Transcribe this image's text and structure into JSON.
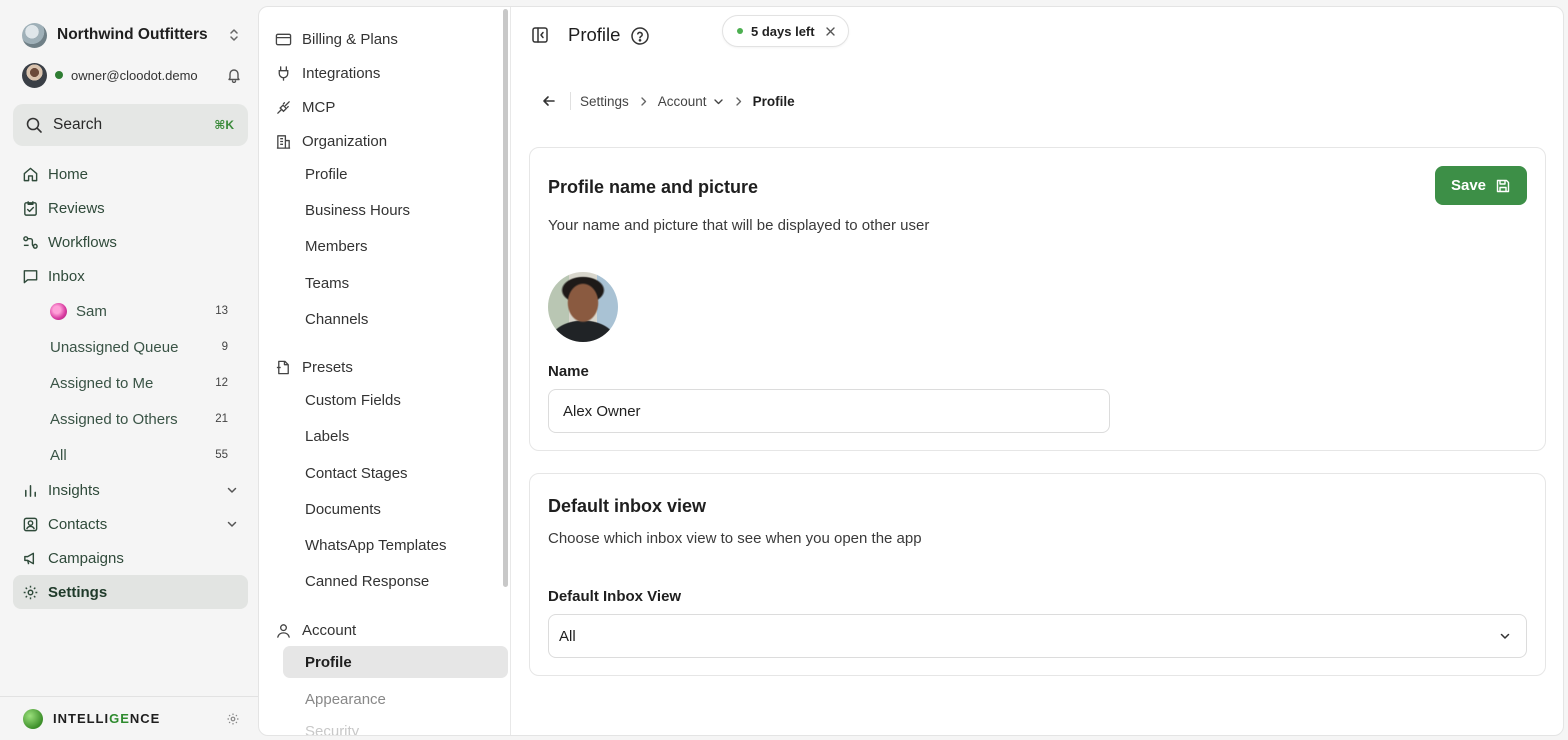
{
  "workspace": {
    "name": "Northwind Outfitters"
  },
  "user": {
    "email": "owner@cloodot.demo"
  },
  "search": {
    "label": "Search",
    "shortcut": "⌘K"
  },
  "nav": {
    "home": "Home",
    "reviews": "Reviews",
    "workflows": "Workflows",
    "inbox": "Inbox",
    "inbox_items": [
      {
        "label": "Sam",
        "count": "13"
      },
      {
        "label": "Unassigned Queue",
        "count": "9"
      },
      {
        "label": "Assigned to Me",
        "count": "12"
      },
      {
        "label": "Assigned to Others",
        "count": "21"
      },
      {
        "label": "All",
        "count": "55"
      }
    ],
    "insights": "Insights",
    "contacts": "Contacts",
    "campaigns": "Campaigns",
    "settings": "Settings"
  },
  "intelligence": {
    "label_pre": "INTELLI",
    "label_accent": "GE",
    "label_post": "NCE"
  },
  "settings_nav": {
    "billing": "Billing & Plans",
    "integrations": "Integrations",
    "mcp": "MCP",
    "organization": "Organization",
    "org_items": [
      "Profile",
      "Business Hours",
      "Members",
      "Teams",
      "Channels"
    ],
    "presets": "Presets",
    "preset_items": [
      "Custom Fields",
      "Labels",
      "Contact Stages",
      "Documents",
      "WhatsApp Templates",
      "Canned Response"
    ],
    "account": "Account",
    "account_items": [
      "Profile",
      "Appearance",
      "Security"
    ]
  },
  "header": {
    "title": "Profile",
    "trial": "5 days left"
  },
  "breadcrumb": {
    "settings": "Settings",
    "account": "Account",
    "current": "Profile"
  },
  "profile_card": {
    "title": "Profile name and picture",
    "description": "Your name and picture that will be displayed to other user",
    "save_label": "Save",
    "name_label": "Name",
    "name_value": "Alex Owner"
  },
  "inbox_card": {
    "title": "Default inbox view",
    "description": "Choose which inbox view to see when you open the app",
    "field_label": "Default Inbox View",
    "selected": "All"
  },
  "colors": {
    "accent": "#3d8f47",
    "online": "#2e7d32",
    "active_bg": "#e2e4e2"
  }
}
